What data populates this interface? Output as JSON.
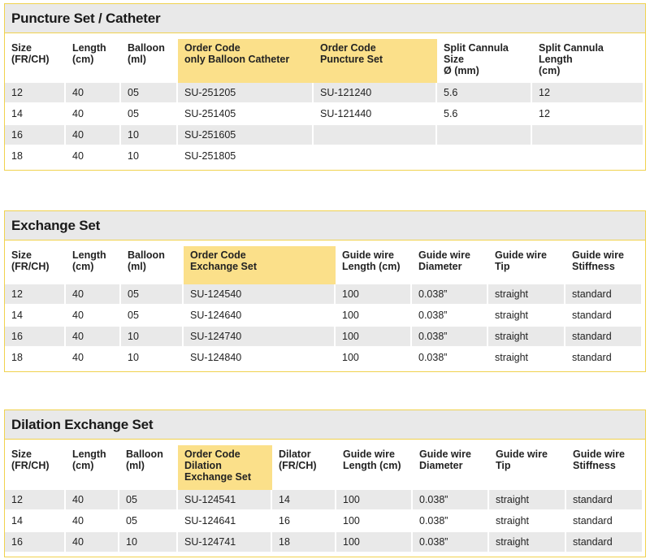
{
  "tables": [
    {
      "title": "Puncture Set / Catheter",
      "headers": [
        "Size\n(FR/CH)",
        "Length\n(cm)",
        "Balloon\n(ml)",
        "Order Code\nonly Balloon Catheter",
        "Order Code\nPuncture Set",
        "Split Cannula\nSize\nØ (mm)",
        "Split Cannula\nLength\n(cm)"
      ],
      "highlighted_columns": [
        3,
        4
      ],
      "rows": [
        [
          "12",
          "40",
          "05",
          "SU-251205",
          "SU-121240",
          "5.6",
          "12"
        ],
        [
          "14",
          "40",
          "05",
          "SU-251405",
          "SU-121440",
          "5.6",
          "12"
        ],
        [
          "16",
          "40",
          "10",
          "SU-251605",
          "",
          "",
          ""
        ],
        [
          "18",
          "40",
          "10",
          "SU-251805",
          "",
          "",
          ""
        ]
      ]
    },
    {
      "title": "Exchange Set",
      "headers": [
        "Size\n(FR/CH)",
        "Length\n(cm)",
        "Balloon\n(ml)",
        "Order Code\nExchange Set",
        "Guide wire\nLength (cm)",
        "Guide wire\nDiameter",
        "Guide wire\nTip",
        "Guide wire\nStiffness"
      ],
      "highlighted_columns": [
        3
      ],
      "rows": [
        [
          "12",
          "40",
          "05",
          "SU-124540",
          "100",
          "0.038”",
          "straight",
          "standard"
        ],
        [
          "14",
          "40",
          "05",
          "SU-124640",
          "100",
          "0.038”",
          "straight",
          "standard"
        ],
        [
          "16",
          "40",
          "10",
          "SU-124740",
          "100",
          "0.038”",
          "straight",
          "standard"
        ],
        [
          "18",
          "40",
          "10",
          "SU-124840",
          "100",
          "0.038”",
          "straight",
          "standard"
        ]
      ]
    },
    {
      "title": "Dilation Exchange Set",
      "headers": [
        "Size\n(FR/CH)",
        "Length\n(cm)",
        "Balloon\n(ml)",
        "Order Code\nDilation\nExchange Set",
        "Dilator\n(FR/CH)",
        "Guide wire\nLength (cm)",
        "Guide wire\nDiameter",
        "Guide wire\nTip",
        "Guide wire\nStiffness"
      ],
      "highlighted_columns": [
        3
      ],
      "rows": [
        [
          "12",
          "40",
          "05",
          "SU-124541",
          "14",
          "100",
          "0.038”",
          "straight",
          "standard"
        ],
        [
          "14",
          "40",
          "05",
          "SU-124641",
          "16",
          "100",
          "0.038”",
          "straight",
          "standard"
        ],
        [
          "16",
          "40",
          "10",
          "SU-124741",
          "18",
          "100",
          "0.038”",
          "straight",
          "standard"
        ]
      ]
    }
  ]
}
